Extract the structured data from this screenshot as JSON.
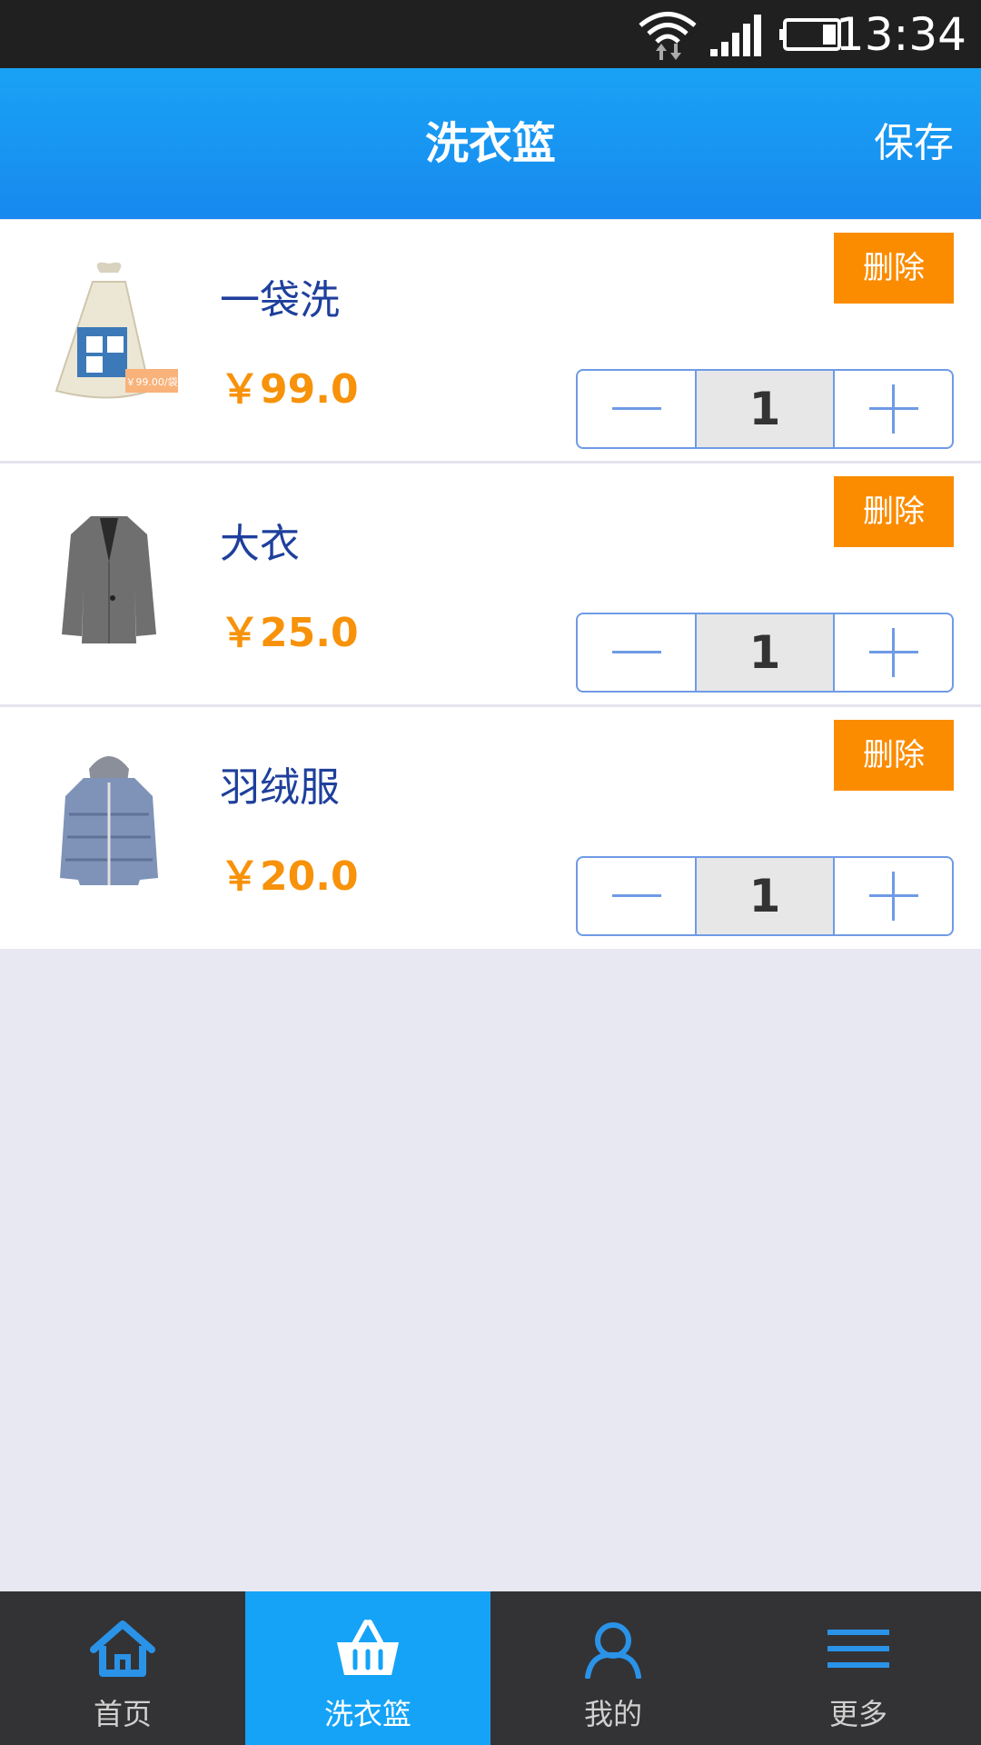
{
  "status_bar": {
    "time": "13:34"
  },
  "header": {
    "title": "洗衣篮",
    "save_label": "保存"
  },
  "items": [
    {
      "name": "一袋洗",
      "price": "￥99.0",
      "quantity": "1",
      "delete_label": "删除",
      "thumb_tag": "￥99.00/袋",
      "icon": "laundry-bag-icon"
    },
    {
      "name": "大衣",
      "price": "￥25.0",
      "quantity": "1",
      "delete_label": "删除",
      "icon": "coat-icon"
    },
    {
      "name": "羽绒服",
      "price": "￥20.0",
      "quantity": "1",
      "delete_label": "删除",
      "icon": "down-jacket-icon"
    }
  ],
  "bottom_nav": [
    {
      "label": "首页",
      "icon": "home-icon",
      "active": false
    },
    {
      "label": "洗衣篮",
      "icon": "basket-icon",
      "active": true
    },
    {
      "label": "我的",
      "icon": "user-icon",
      "active": false
    },
    {
      "label": "更多",
      "icon": "menu-icon",
      "active": false
    }
  ],
  "colors": {
    "accent": "#1789ef",
    "price": "#f7920a",
    "delete": "#fb8c00",
    "name": "#1e3f9c"
  }
}
